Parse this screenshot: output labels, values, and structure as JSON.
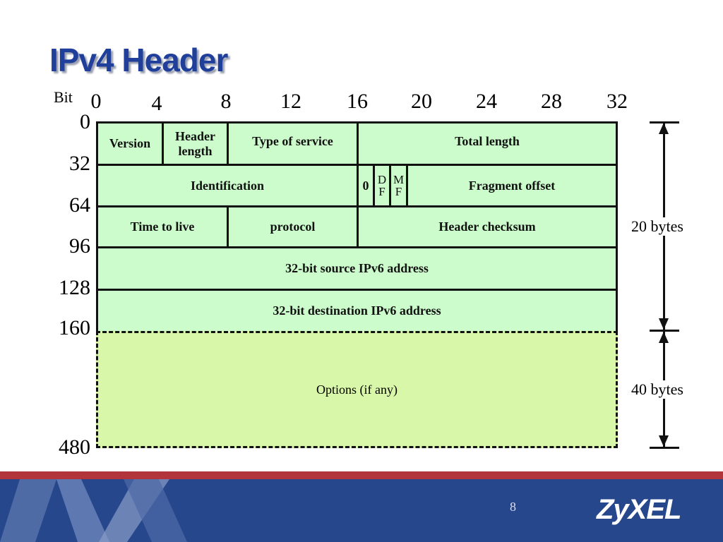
{
  "slide": {
    "title": "IPv4 Header",
    "page_number": "8",
    "logo": "ZyXEL"
  },
  "diagram": {
    "bit_label": "Bit",
    "bit_ticks": [
      "0",
      "4",
      "8",
      "12",
      "16",
      "20",
      "24",
      "28",
      "32"
    ],
    "row_offsets": [
      "0",
      "32",
      "64",
      "96",
      "128",
      "160",
      "480"
    ],
    "fields": {
      "version": "Version",
      "header_length_1": "Header",
      "header_length_2": "length",
      "type_of_service": "Type of service",
      "total_length": "Total length",
      "identification": "Identification",
      "zero": "0",
      "df_1": "D",
      "df_2": "F",
      "mf_1": "M",
      "mf_2": "F",
      "fragment_offset": "Fragment offset",
      "ttl": "Time to live",
      "protocol": "protocol",
      "header_checksum": "Header checksum",
      "source": "32-bit source IPv6 address",
      "destination": "32-bit destination IPv6 address",
      "options": "Options (if any)"
    },
    "sizes": {
      "header": "20 bytes",
      "options": "40 bytes"
    },
    "colors": {
      "field_fill": "#ccfccc",
      "options_fill": "#d9f7a8",
      "title": "#1f3f9b",
      "footer": "#27478c",
      "band": "#b3353c"
    }
  }
}
